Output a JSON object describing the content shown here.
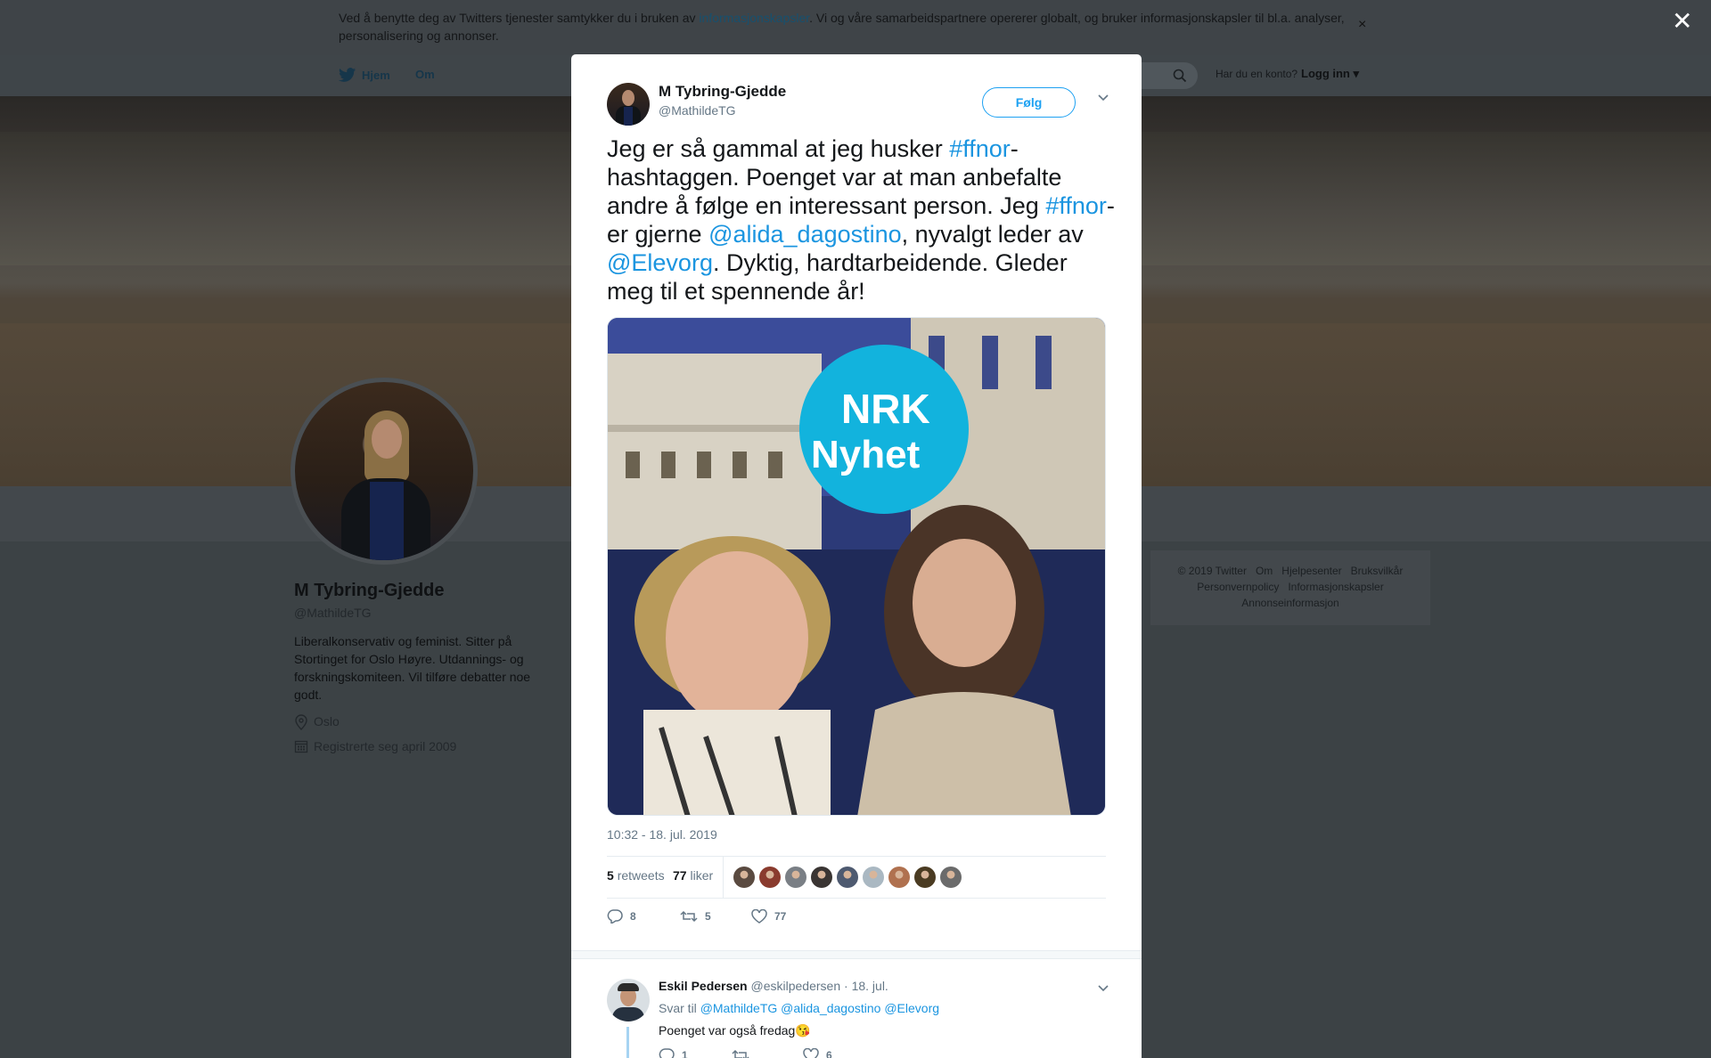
{
  "background": {
    "cookie": {
      "text_before": "Ved å benytte deg av Twitters tjenester samtykker du i bruken av ",
      "link": "informasjonskapsler",
      "text_after": ". Vi og våre samarbeidspartnere opererer globalt, og bruker informasjonskapsler til bl.a. analyser, personalisering og annonser.",
      "close": "×"
    },
    "nav": {
      "home": "Hjem",
      "about": "Om",
      "account_prompt": "Har du en konto?",
      "login": "Logg inn"
    },
    "profile": {
      "name": "M Tybring-Gjedde",
      "handle": "@MathildeTG",
      "bio": "Liberalkonservativ og feminist. Sitter på Stortinget for Oslo Høyre. Utdannings- og forskningskomiteen. Vil tilføre debatter noe godt.",
      "location": "Oslo",
      "joined": "Registrerte seg april 2009"
    },
    "footer": {
      "copyright": "© 2019 Twitter",
      "about": "Om",
      "help": "Hjelpesenter",
      "terms": "Bruksvilkår",
      "privacy": "Personvernpolicy",
      "cookies": "Informasjonskapsler",
      "ads": "Annonseinformasjon"
    },
    "overlay_close": "✕"
  },
  "tweet": {
    "author_name": "M Tybring-Gjedde",
    "author_handle": "@MathildeTG",
    "follow_label": "Følg",
    "text_parts": [
      {
        "t": "Jeg er så gammal at jeg husker ",
        "link": false
      },
      {
        "t": "#ffnor",
        "link": true
      },
      {
        "t": "-hashtaggen. Poenget var at man anbefalte andre å følge en interessant person. Jeg ",
        "link": false
      },
      {
        "t": "#ffnor",
        "link": true
      },
      {
        "t": "-er gjerne ",
        "link": false
      },
      {
        "t": "@alida_dagostino",
        "link": true
      },
      {
        "t": ", nyvalgt leder av ",
        "link": false
      },
      {
        "t": "@Elevorg",
        "link": true
      },
      {
        "t": ". Dyktig, hardtarbeidende. Gleder meg til et spennende år!",
        "link": false
      }
    ],
    "photo_sign_line1": "NRK",
    "photo_sign_line2": "Nyhet",
    "timestamp": "10:32 - 18. jul. 2019",
    "retweets_count": "5",
    "retweets_label": "retweets",
    "likes_count": "77",
    "likes_label": "liker",
    "liker_colors": [
      "#5a4a40",
      "#8a3b2e",
      "#7a7f85",
      "#3a3533",
      "#4e5a70",
      "#aab8c2",
      "#b0714f",
      "#4a3b22",
      "#6b6b6b"
    ],
    "actions": {
      "replies": "8",
      "retweets": "5",
      "likes": "77"
    }
  },
  "reply": {
    "name": "Eskil Pedersen",
    "handle": "@eskilpedersen",
    "date": "· 18. jul.",
    "reply_to_label": "Svar til",
    "reply_to": [
      "@MathildeTG",
      "@alida_dagostino",
      "@Elevorg"
    ],
    "text": "Poenget var også fredag",
    "emoji": "😘",
    "actions": {
      "replies": "1",
      "retweets": "",
      "likes": "6"
    }
  },
  "colors": {
    "twitter_blue": "#1da1f2",
    "link_blue": "#1b95e0",
    "muted": "#657786"
  }
}
